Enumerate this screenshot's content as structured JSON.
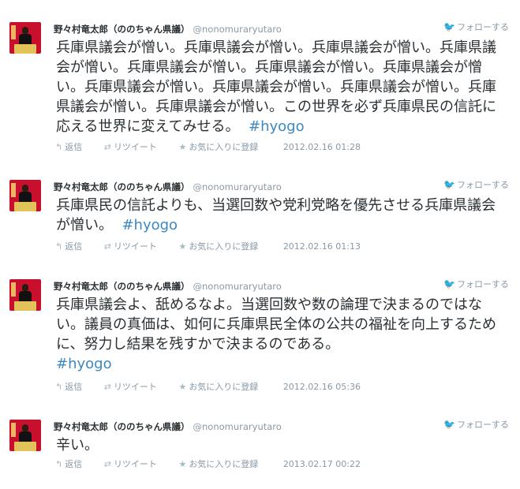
{
  "follow_label": "フォローする",
  "actions": {
    "reply": "返信",
    "retweet": "リツイート",
    "favorite": "お気に入りに登録"
  },
  "user": {
    "name": "野々村竜太郎（ののちゃん県議）",
    "handle": "@nonomuraryutaro"
  },
  "tweets": [
    {
      "text": "兵庫県議会が憎い。兵庫県議会が憎い。兵庫県議会が憎い。兵庫県議会が憎い。兵庫県議会が憎い。兵庫県議会が憎い。兵庫県議会が憎い。兵庫県議会が憎い。兵庫県議会が憎い。兵庫県議会が憎い。兵庫県議会が憎い。兵庫県議会が憎い。この世界を必ず兵庫県民の信託に応える世界に変えてみせる。",
      "hashtag": "#hyogo",
      "date": "2012.02.16 01:28"
    },
    {
      "text": "兵庫県民の信託よりも、当選回数や党利党略を優先させる兵庫県議会が憎い。",
      "hashtag": "#hyogo",
      "date": "2012.02.16 01:13"
    },
    {
      "text": "兵庫県議会よ、舐めるなよ。当選回数や数の論理で決まるのではない。議員の真価は、如何に兵庫県民全体の公共の福祉を向上するために、努力し結果を残すかで決まるのである。",
      "hashtag": "#hyogo",
      "date": "2012.02.16 05:36"
    },
    {
      "text": "辛い。",
      "hashtag": "",
      "date": "2013.02.17 00:22"
    }
  ]
}
